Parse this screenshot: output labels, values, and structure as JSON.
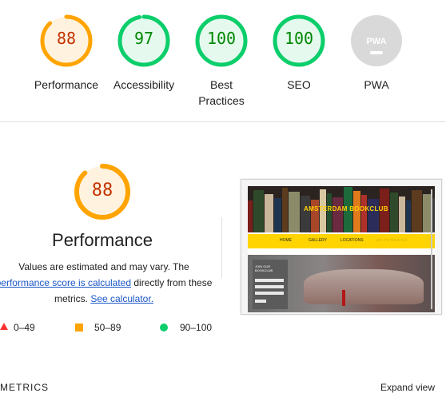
{
  "gauges": [
    {
      "label": "Performance",
      "score": "88",
      "value": 0.88,
      "color": "#ffa400",
      "text_color": "#c33300",
      "bg": "#fff3e0"
    },
    {
      "label": "Accessibility",
      "score": "97",
      "value": 0.97,
      "color": "#0cce6b",
      "text_color": "#008800",
      "bg": "#e6f9ee"
    },
    {
      "label": "Best Practices",
      "score": "100",
      "value": 1.0,
      "color": "#0cce6b",
      "text_color": "#008800",
      "bg": "#e6f9ee"
    },
    {
      "label": "SEO",
      "score": "100",
      "value": 1.0,
      "color": "#0cce6b",
      "text_color": "#008800",
      "bg": "#e6f9ee"
    },
    {
      "label": "PWA",
      "score": "",
      "value": 0,
      "color": "#d9d9d9",
      "text_color": "#ffffff",
      "bg": "#d9d9d9",
      "badge": "PWA"
    }
  ],
  "performance": {
    "score": "88",
    "value": 0.88,
    "title": "Performance",
    "desc_1": "Values are estimated and may vary. The",
    "link_1": "performance score is calculated",
    "desc_2": "directly from these",
    "desc_3": "metrics.",
    "link_2": "See calculator."
  },
  "legend": [
    {
      "range": "0–49",
      "shape": "triangle",
      "color": "#ff3333"
    },
    {
      "range": "50–89",
      "shape": "square",
      "color": "#ffa400"
    },
    {
      "range": "90–100",
      "shape": "circle",
      "color": "#0cce6b"
    }
  ],
  "thumbnail": {
    "site_title": "AMSTERDAM BOOKCLUB",
    "nav": [
      "HOME",
      "GALLERY",
      "LOCATIONS",
      "Join the Bookclub"
    ],
    "form_title": "JOIN OUR BOOKCLUB"
  },
  "metrics_header": "METRICS",
  "expand_label": "Expand view"
}
